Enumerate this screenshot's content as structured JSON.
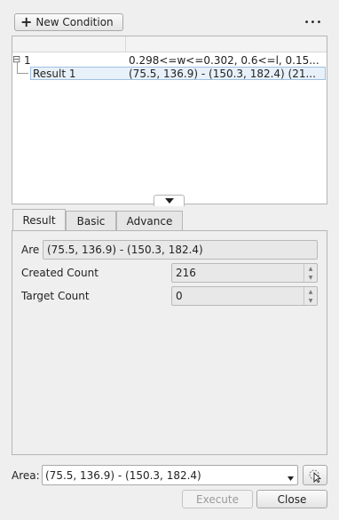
{
  "toolbar": {
    "new_condition_label": "New Condition",
    "plus_icon": "+",
    "more_icon": "•••"
  },
  "tree": {
    "columns": [
      "",
      ""
    ],
    "rows": [
      {
        "expander": "⊟",
        "label": "1",
        "value": "0.298<=w<=0.302, 0.6<=l, 0.15..."
      },
      {
        "label": "Result 1",
        "value": "(75.5, 136.9) - (150.3, 182.4) (21..."
      }
    ]
  },
  "tabs": [
    "Result",
    "Basic",
    "Advance"
  ],
  "result_panel": {
    "area_label": "Are",
    "area_value": "(75.5, 136.9) - (150.3, 182.4)",
    "created_count_label": "Created Count",
    "created_count_value": "216",
    "target_count_label": "Target Count",
    "target_count_value": "0"
  },
  "footer": {
    "area_label": "Area:",
    "area_value": "(75.5, 136.9) - (150.3, 182.4)",
    "execute_label": "Execute",
    "close_label": "Close"
  }
}
